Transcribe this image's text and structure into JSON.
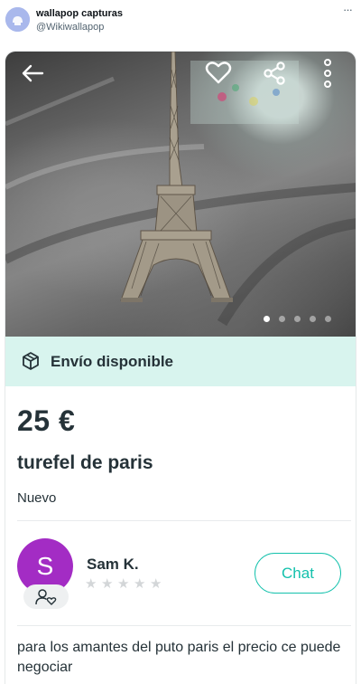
{
  "tweet": {
    "account_name": "wallapop capturas",
    "account_handle": "@Wikiwallapop",
    "more_glyph": "···"
  },
  "listing": {
    "photo": {
      "image_count": 5,
      "active_index": 0
    },
    "shipping": {
      "label": "Envío disponible",
      "icon": "package-icon"
    },
    "price": "25 €",
    "title": "turefel de paris",
    "condition": "Nuevo",
    "seller": {
      "initial": "S",
      "name": "Sam K.",
      "rating_stars": 0,
      "rating_max": 5,
      "chat_label": "Chat"
    },
    "description": "para los amantes del puto paris  el precio ce puede negociar"
  },
  "colors": {
    "accent": "#13c1ac",
    "shipping_banner": "#d8f4ee",
    "seller_avatar": "#a32cc4",
    "text": "#253238"
  },
  "icons": [
    "back-arrow-icon",
    "heart-icon",
    "share-icon",
    "kebab-menu-icon",
    "package-icon",
    "user-heart-icon",
    "star-icon"
  ]
}
